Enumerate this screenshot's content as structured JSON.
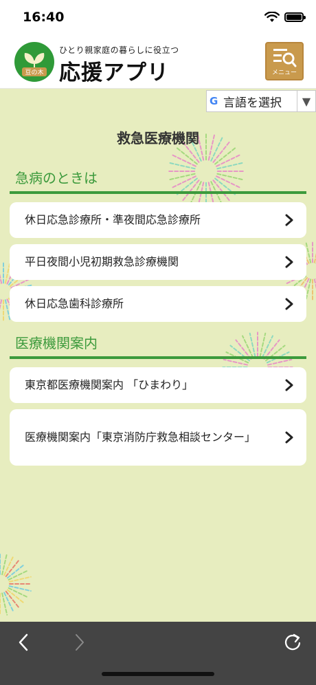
{
  "status_bar": {
    "time": "16:40"
  },
  "header": {
    "logo_badge_text": "豆の木",
    "tagline": "ひとり親家庭の暮らしに役立つ",
    "app_title": "応援アプリ",
    "menu_label": "メニュー"
  },
  "translate": {
    "google_letter": "G",
    "label": "言語を選択",
    "arrow": "▼"
  },
  "page": {
    "title": "救急医療機関"
  },
  "sections": [
    {
      "heading": "急病のときは",
      "items": [
        {
          "label": "休日応急診療所・準夜間応急診療所"
        },
        {
          "label": "平日夜間小児初期救急診療機関"
        },
        {
          "label": "休日応急歯科診療所"
        }
      ]
    },
    {
      "heading": "医療機関案内",
      "items": [
        {
          "label": "東京都医療機関案内 「ひまわり」"
        },
        {
          "label": "医療機関案内「東京消防庁救急相談センター」"
        }
      ]
    }
  ],
  "colors": {
    "accent_green": "#3c9a3c",
    "page_background": "#e7edbf",
    "menu_button": "#c99a4d",
    "toolbar": "#444444"
  },
  "icons": {
    "menu": "menu-search-icon",
    "chevron": "chevron-right-icon",
    "back": "back-arrow-icon",
    "forward": "forward-arrow-icon",
    "reload": "reload-icon"
  }
}
